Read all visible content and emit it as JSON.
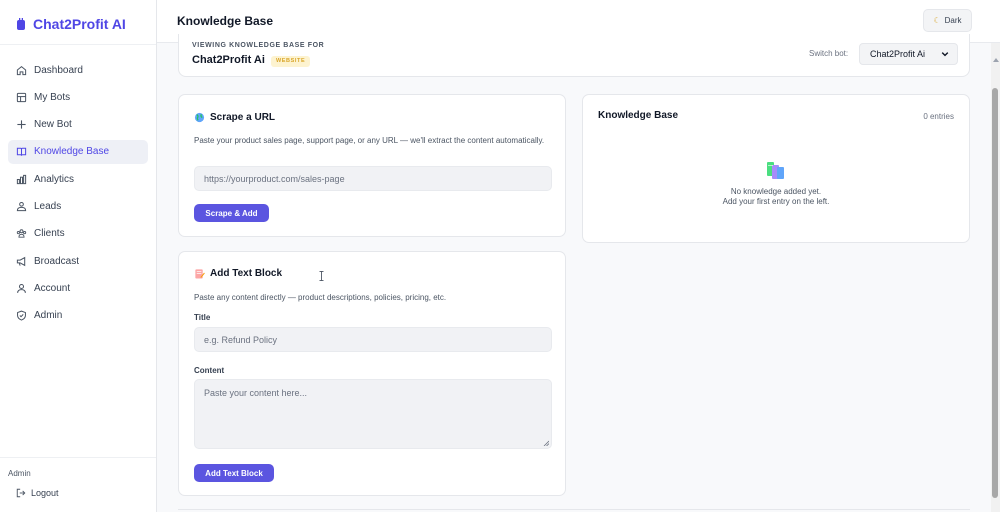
{
  "brand": {
    "name": "Chat2Profit AI",
    "color": "#4f46e5"
  },
  "nav": [
    {
      "label": "Dashboard",
      "icon": "home-icon",
      "active": false
    },
    {
      "label": "My Bots",
      "icon": "grid-icon",
      "active": false
    },
    {
      "label": "New Bot",
      "icon": "plus-icon",
      "active": false
    },
    {
      "label": "Knowledge Base",
      "icon": "book-icon",
      "active": true
    },
    {
      "label": "Analytics",
      "icon": "bar-chart-icon",
      "active": false
    },
    {
      "label": "Leads",
      "icon": "users-icon",
      "active": false
    },
    {
      "label": "Clients",
      "icon": "group-icon",
      "active": false
    },
    {
      "label": "Broadcast",
      "icon": "megaphone-icon",
      "active": false
    },
    {
      "label": "Account",
      "icon": "user-icon",
      "active": false
    },
    {
      "label": "Admin",
      "icon": "shield-icon",
      "active": false
    }
  ],
  "sidebar_footer": {
    "role": "Admin",
    "logout_label": "Logout"
  },
  "header": {
    "title": "Knowledge Base",
    "theme_toggle_label": "Dark"
  },
  "bot_header": {
    "viewing_label": "VIEWING KNOWLEDGE BASE FOR",
    "bot_name": "Chat2Profit Ai",
    "badge": "WEBSITE",
    "switch_label": "Switch bot:",
    "selected_bot": "Chat2Profit Ai"
  },
  "scrape": {
    "title": "Scrape a URL",
    "icon": "globe-icon",
    "description": "Paste your product sales page, support page, or any URL — we'll extract the content automatically.",
    "url_placeholder": "https://yourproduct.com/sales-page",
    "button_label": "Scrape & Add"
  },
  "text_block": {
    "title": "Add Text Block",
    "icon": "memo-icon",
    "description": "Paste any content directly — product descriptions, policies, pricing, etc.",
    "title_label": "Title",
    "title_placeholder": "e.g. Refund Policy",
    "content_label": "Content",
    "content_placeholder": "Paste your content here...",
    "button_label": "Add Text Block"
  },
  "knowledge_base": {
    "title": "Knowledge Base",
    "count": "0 entries",
    "empty_line1": "No knowledge added yet.",
    "empty_line2": "Add your first entry on the left."
  },
  "colors": {
    "primary": "#5b55e0",
    "badge_bg": "#fdf3d0",
    "badge_text": "#d9a62b"
  }
}
